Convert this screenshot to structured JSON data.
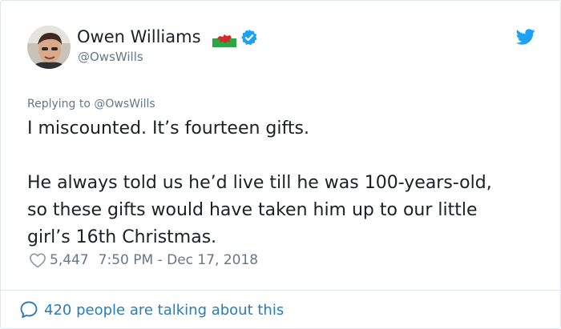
{
  "tweet": {
    "author": {
      "name": "Owen Williams",
      "handle": "@OwsWills",
      "avatar_icon": "avatar-photo",
      "flag_icon": "wales-flag-icon",
      "verified_icon": "verified-badge-icon"
    },
    "platform_icon": "twitter-bird-icon",
    "replying_to_label": "Replying to",
    "replying_to_handle": "@OwsWills",
    "body": {
      "line1": "I miscounted. It’s fourteen gifts.",
      "line2": "He always told us he’d live till he was 100-years-old,",
      "line3": "so these gifts would have taken him up to our little",
      "line4": "girl’s 16th Christmas."
    },
    "likes_count": "5,447",
    "timestamp": "7:50 PM - Dec 17, 2018",
    "talking_text": "420 people are talking about this"
  },
  "colors": {
    "link_blue": "#2b7bb9",
    "twitter_blue": "#1da1f2",
    "muted_gray": "#657786",
    "text_dark": "#1c2022",
    "border": "#e1e8ed"
  }
}
